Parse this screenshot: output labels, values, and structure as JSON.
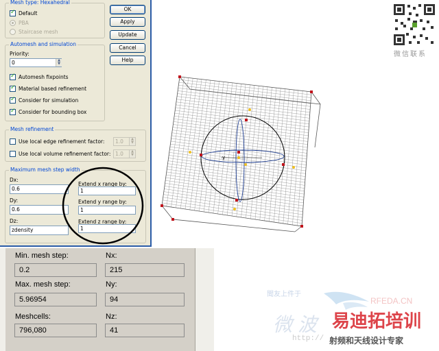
{
  "dialog": {
    "mesh_type": {
      "title": "Mesh type: Hexahedral",
      "default_label": "Default",
      "pba_label": "PBA",
      "staircase_label": "Staircase mesh"
    },
    "buttons": {
      "ok": "OK",
      "apply": "Apply",
      "update": "Update",
      "cancel": "Cancel",
      "help": "Help"
    },
    "automesh": {
      "title": "Automesh and simulation",
      "priority_label": "Priority:",
      "priority_value": "0",
      "fixpoints": "Automesh fixpoints",
      "material_refinement": "Material based refinement",
      "consider_simulation": "Consider for simulation",
      "consider_bounding": "Consider for bounding box"
    },
    "refinement": {
      "title": "Mesh refinement",
      "local_edge": "Use local edge refinement factor:",
      "local_edge_value": "1.0",
      "local_volume": "Use local volume refinement factor:",
      "local_volume_value": "1.0"
    },
    "step_width": {
      "title": "Maximum mesh step width",
      "dx_label": "Dx:",
      "dx_value": "0.6",
      "dy_label": "Dy:",
      "dy_value": "0.6",
      "dz_label": "Dz:",
      "dz_value": "zdensity",
      "ext_x_label": "Extend x range by:",
      "ext_x_value": "1",
      "ext_y_label": "Extend y range by:",
      "ext_y_value": "1",
      "ext_z_label": "Extend z range by:",
      "ext_z_value": "1"
    }
  },
  "stats": {
    "min_step_label": "Min. mesh step:",
    "min_step_value": "0.2",
    "max_step_label": "Max. mesh step:",
    "max_step_value": "5.96954",
    "meshcells_label": "Meshcells:",
    "meshcells_value": "796,080",
    "nx_label": "Nx:",
    "nx_value": "215",
    "ny_label": "Ny:",
    "ny_value": "94",
    "nz_label": "Nz:",
    "nz_value": "41"
  },
  "viewport": {
    "axis_label": "y"
  },
  "watermark": {
    "qr_caption": "微信联系",
    "site": "RFEDA.CN",
    "brand": "易迪拓培训",
    "tagline": "射频和天线设计专家",
    "url": "http://",
    "faint_text": "微波",
    "faint_small": "聞友上件于"
  },
  "colors": {
    "accent": "#0046d5",
    "highlight_circle": "#000000",
    "brand_red": "#d8242b",
    "node_red": "#c0141c",
    "node_yellow": "#f0c020"
  }
}
